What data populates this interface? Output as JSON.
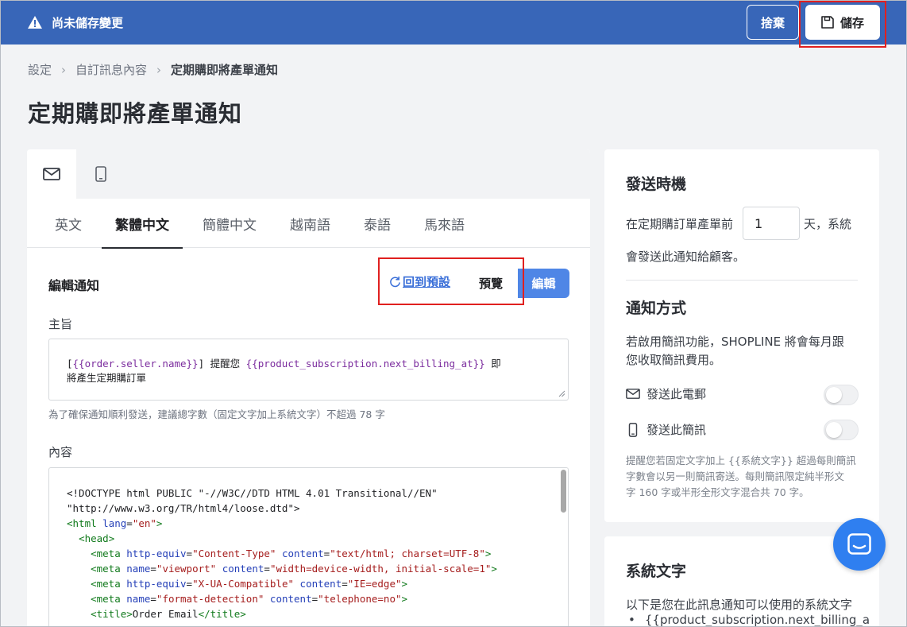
{
  "topbar": {
    "unsaved_text": "尚未儲存變更",
    "discard_label": "捨棄",
    "save_label": "儲存"
  },
  "breadcrumb": {
    "items": [
      "設定",
      "自訂訊息內容",
      "定期購即將產單通知"
    ]
  },
  "page_title": "定期購即將產單通知",
  "channel_tabs": [
    {
      "icon": "mail-icon",
      "active": true
    },
    {
      "icon": "mobile-icon",
      "active": false
    }
  ],
  "lang_tabs": [
    "英文",
    "繁體中文",
    "簡體中文",
    "越南語",
    "泰語",
    "馬來語"
  ],
  "lang_active": "繁體中文",
  "editor": {
    "heading": "編輯通知",
    "reset_label": "回到預設",
    "preview_label": "預覽",
    "edit_label": "編輯",
    "subject_label": "主旨",
    "subject_line1_pre": "[",
    "subject_var1": "{{order.seller.name}}",
    "subject_line1_mid": "] 提醒您 ",
    "subject_var2": "{{product_subscription.next_billing_at}}",
    "subject_line1_post": " 即",
    "subject_line2": "將產生定期購訂單",
    "hint": "為了確保通知順利發送，建議總字數（固定文字加上系統文字）不超過 78 字",
    "content_label": "內容"
  },
  "code": {
    "l1": "<!DOCTYPE html PUBLIC \"-//W3C//DTD HTML 4.01 Transitional//EN\"",
    "l2": "\"http://www.w3.org/TR/html4/loose.dtd\">",
    "l3_tag": "<html",
    "l3_attr": "lang",
    "l3_val": "\"en\"",
    "l4_tag": "<head>",
    "l5_attr1": "http-equiv",
    "l5_val1": "\"Content-Type\"",
    "l5_attr2": "content",
    "l5_val2": "\"text/html; charset=UTF-8\"",
    "l6_attr1": "name",
    "l6_val1": "\"viewport\"",
    "l6_attr2": "content",
    "l6_val2": "\"width=device-width, initial-scale=1\"",
    "l7_attr1": "http-equiv",
    "l7_val1": "\"X-UA-Compatible\"",
    "l7_attr2": "content",
    "l7_val2": "\"IE=edge\"",
    "l8_attr1": "name",
    "l8_val1": "\"format-detection\"",
    "l8_attr2": "content",
    "l8_val2": "\"telephone=no\"",
    "l9_open": "<title>",
    "l9_text": "Order Email",
    "l9_close": "</title>",
    "meta_tag": "<meta",
    "gt": ">",
    "eq": "="
  },
  "timing": {
    "title": "發送時機",
    "prefix": "在定期購訂單產單前",
    "days": "1",
    "suffix": "天，系統",
    "line2": "會發送此通知給顧客。"
  },
  "notify": {
    "title": "通知方式",
    "desc_line1": "若啟用簡訊功能，SHOPLINE 將會每月跟",
    "desc_line2": "您收取簡訊費用。",
    "email_label": "發送此電郵",
    "email_on": false,
    "sms_label": "發送此簡訊",
    "sms_on": false,
    "note_line1": "提醒您若固定文字加上 {{系統文字}} 超過每則簡訊",
    "note_line2": "字數會以另一則簡訊寄送。每則簡訊限定純半形文",
    "note_line3": "字 160 字或半形全形文字混合共 70 字。"
  },
  "system_text": {
    "title": "系統文字",
    "desc": "以下是您在此訊息通知可以使用的系統文字",
    "first_item": "{{product_subscription.next_billing_a"
  },
  "colors": {
    "topbar": "#3866b8",
    "accent": "#4f86e6",
    "highlight": "#e0201f",
    "chat": "#2f7ff0"
  }
}
